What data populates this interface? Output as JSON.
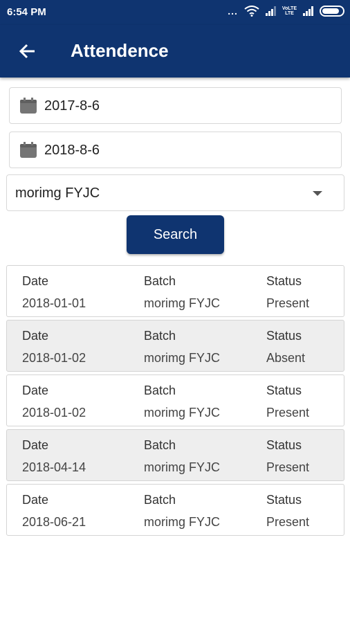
{
  "status_bar": {
    "time": "6:54 PM",
    "dots": "...",
    "volte_label_top": "VoLTE",
    "volte_label_bottom": "LTE",
    "icons": [
      "wifi-icon",
      "signal-icon",
      "volte-icon",
      "signal-icon",
      "battery-icon"
    ]
  },
  "app_bar": {
    "title": "Attendence",
    "back_icon": "arrow-left-icon",
    "color": "#0f3470"
  },
  "form": {
    "from_date": "2017-8-6",
    "to_date": "2018-8-6",
    "batch_selected": "morimg FYJC",
    "search_label": "Search"
  },
  "columns": {
    "date": "Date",
    "batch": "Batch",
    "status": "Status"
  },
  "records": [
    {
      "date": "2018-01-01",
      "batch": "morimg FYJC",
      "status": "Present"
    },
    {
      "date": "2018-01-02",
      "batch": "morimg FYJC",
      "status": "Absent"
    },
    {
      "date": "2018-01-02",
      "batch": "morimg FYJC",
      "status": "Present"
    },
    {
      "date": "2018-04-14",
      "batch": "morimg FYJC",
      "status": "Present"
    },
    {
      "date": "2018-06-21",
      "batch": "morimg FYJC",
      "status": "Present"
    }
  ]
}
